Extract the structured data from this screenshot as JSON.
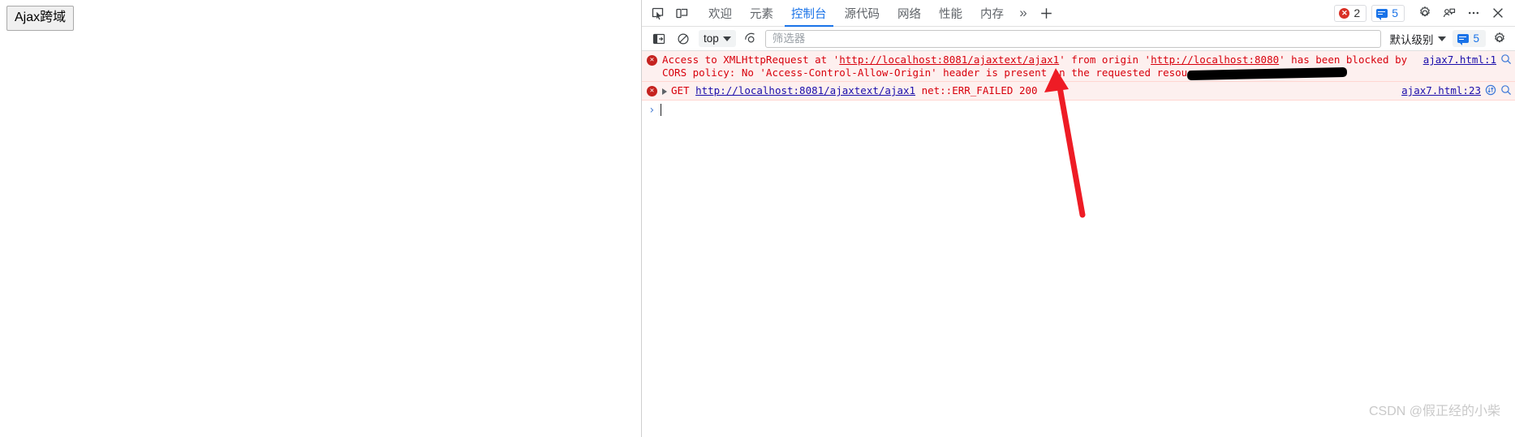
{
  "page": {
    "button_label": "Ajax跨域"
  },
  "devtools": {
    "tabs": [
      {
        "label": "欢迎",
        "active": false
      },
      {
        "label": "元素",
        "active": false
      },
      {
        "label": "控制台",
        "active": true
      },
      {
        "label": "源代码",
        "active": false
      },
      {
        "label": "网络",
        "active": false
      },
      {
        "label": "性能",
        "active": false
      },
      {
        "label": "内存",
        "active": false
      }
    ],
    "overflow_label": "»",
    "add_label": "+",
    "error_badge": {
      "count": "2",
      "icon": "error-circle-icon"
    },
    "message_badge": {
      "count": "5",
      "icon": "message-bubble-icon"
    },
    "icons": {
      "inspect": "inspect-element-icon",
      "device": "device-toolbar-icon",
      "settings": "gear-icon",
      "feedback": "feedback-icon",
      "more": "more-options-icon",
      "close": "close-icon"
    }
  },
  "toolbar": {
    "sidebar_icon": "console-sidebar-icon",
    "clear_icon": "clear-console-icon",
    "context": "top",
    "eye_icon": "live-expression-icon",
    "filter_placeholder": "筛选器",
    "filter_value": "",
    "level": "默认级别",
    "message_count": "5",
    "settings_icon": "gear-icon"
  },
  "console": {
    "messages": [
      {
        "type": "error",
        "icon": "error-circle-icon",
        "segments": [
          {
            "text": "Access to XMLHttpRequest at '",
            "link": false
          },
          {
            "text": "http://localhost:8081/ajaxtext/ajax1",
            "link": true
          },
          {
            "text": "' from origin '",
            "link": false
          },
          {
            "text": "http://localhost:8080",
            "link": true
          },
          {
            "text": "' has been blocked by CORS policy: No 'Access-Control-Allow-Origin' header is present on the requested resource.",
            "link": false
          }
        ],
        "source": "ajax7.html:1",
        "trailing_icons": [
          "search-icon"
        ]
      },
      {
        "type": "error",
        "icon": "error-circle-icon",
        "expandable": true,
        "method": "GET",
        "url": "http://localhost:8081/ajaxtext/ajax1",
        "status_text": "net::ERR_FAILED 200",
        "source": "ajax7.html:23",
        "trailing_icons": [
          "network-request-icon",
          "search-icon"
        ]
      }
    ],
    "prompt": {
      "arrow": "›",
      "value": ""
    }
  },
  "annotations": {
    "blackout_label": "redaction-bar",
    "arrow_label": "red-pointer-arrow",
    "arrow_color": "#ee1c25",
    "blackout_color": "#000000"
  },
  "watermark": {
    "text": "CSDN @假正经的小柴"
  }
}
